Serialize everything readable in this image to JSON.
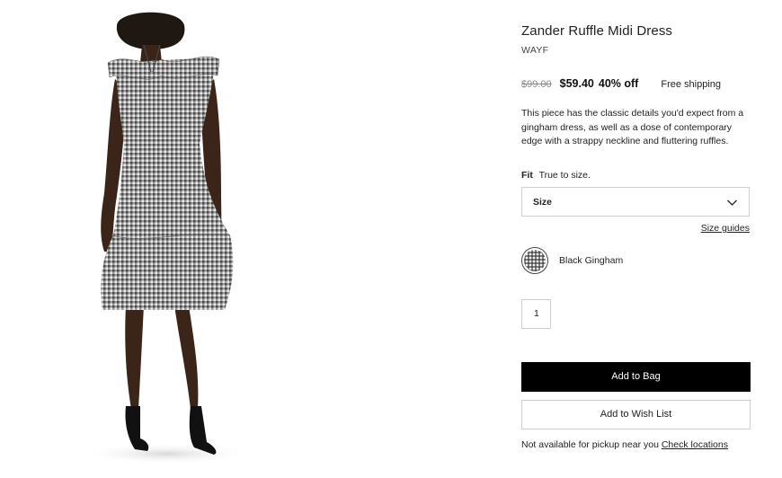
{
  "product": {
    "title": "Zander Ruffle Midi Dress",
    "brand": "WAYF",
    "original_price": "$99.00",
    "sale_price": "$59.40",
    "discount": "40% off",
    "shipping": "Free shipping",
    "description": "This piece has the classic details you'd expect from a gingham dress, as well as a dose of contemporary edge with a strappy neckline and fluttering ruffles.",
    "fit_label": "Fit",
    "fit_value": "True to size.",
    "size_select_label": "Size",
    "size_guides_label": "Size guides",
    "color_name": "Black Gingham",
    "quantity": "1",
    "add_to_bag_label": "Add to Bag",
    "wish_list_label": "Add to Wish List",
    "pickup_text": "Not available for pickup near you",
    "check_locations_label": "Check locations"
  },
  "icons": {
    "size_dropdown": "chevron-down-icon"
  },
  "colors": {
    "primary_button": "#000000",
    "text": "#222222",
    "border": "#cfcfcf"
  }
}
